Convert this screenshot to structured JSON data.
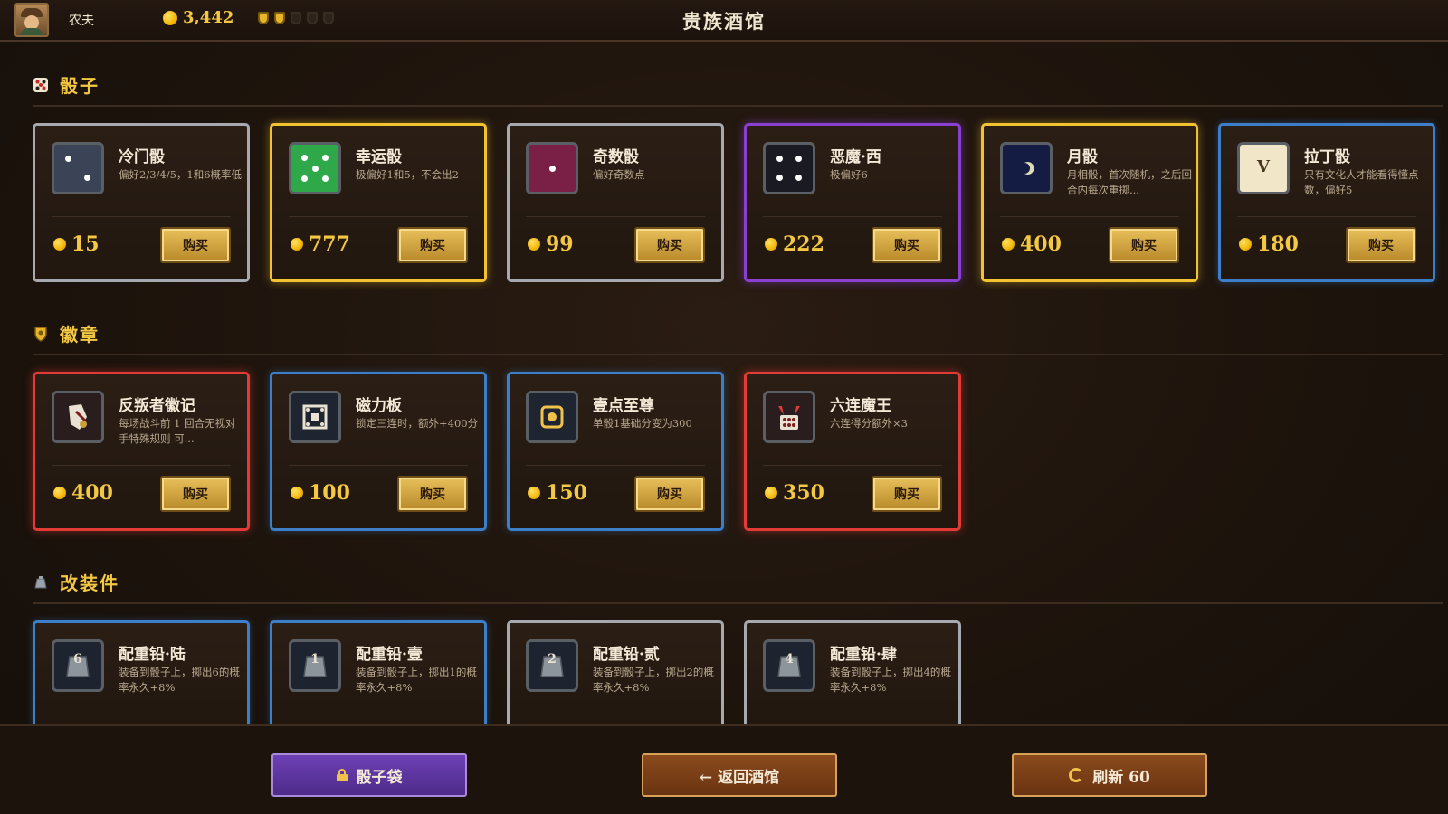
{
  "header": {
    "player_name": "农夫",
    "gold": "3,442",
    "shields": [
      "on",
      "on",
      "off",
      "off",
      "off"
    ],
    "title": "贵族酒馆"
  },
  "sections": {
    "dice": {
      "label": "骰子",
      "items": [
        {
          "name": "冷门骰",
          "desc": "偏好2/3/4/5，1和6概率低",
          "price": "15",
          "buy": "购买",
          "rarity": "gray",
          "icon": "dice-two-icon",
          "icon_color": "#3a4456"
        },
        {
          "name": "幸运骰",
          "desc": "极偏好1和5，不会出2",
          "price": "777",
          "buy": "购买",
          "rarity": "gold",
          "icon": "dice-five-icon",
          "icon_color": "#2fa84a"
        },
        {
          "name": "奇数骰",
          "desc": "偏好奇数点",
          "price": "99",
          "buy": "购买",
          "rarity": "gray",
          "icon": "dice-one-icon",
          "icon_color": "#7a1f45"
        },
        {
          "name": "恶魔·西",
          "desc": "极偏好6",
          "price": "222",
          "buy": "购买",
          "rarity": "purple",
          "icon": "dice-four-icon",
          "icon_color": "#1a1a22"
        },
        {
          "name": "月骰",
          "desc": "月相骰，首次随机，之后回合内每次重掷...",
          "price": "400",
          "buy": "购买",
          "rarity": "gold",
          "icon": "moon-dice-icon",
          "icon_color": "#141c44"
        },
        {
          "name": "拉丁骰",
          "desc": "只有文化人才能看得懂点数，偏好5",
          "price": "180",
          "buy": "购买",
          "rarity": "blue",
          "icon": "latin-dice-icon",
          "icon_color": "#f1e6c8",
          "glyph": "V"
        }
      ]
    },
    "badges": {
      "label": "徽章",
      "items": [
        {
          "name": "反叛者徽记",
          "desc": "每场战斗前 1 回合无视对手特殊规则 可...",
          "price": "400",
          "buy": "购买",
          "rarity": "red",
          "icon": "rebel-badge-icon",
          "icon_color": "#2a1d1d"
        },
        {
          "name": "磁力板",
          "desc": "锁定三连时，额外+400分",
          "price": "100",
          "buy": "购买",
          "rarity": "blue",
          "icon": "magnet-board-icon",
          "icon_color": "#1e2430"
        },
        {
          "name": "壹点至尊",
          "desc": "单骰1基础分变为300",
          "price": "150",
          "buy": "购买",
          "rarity": "blue",
          "icon": "one-supreme-icon",
          "icon_color": "#1e2430"
        },
        {
          "name": "六连魔王",
          "desc": "六连得分额外×3",
          "price": "350",
          "buy": "购买",
          "rarity": "red",
          "icon": "six-demon-icon",
          "icon_color": "#2a1d1d"
        }
      ]
    },
    "mods": {
      "label": "改装件",
      "items": [
        {
          "name": "配重铅·陆",
          "desc": "装备到骰子上，掷出6的概率永久+8%",
          "rarity": "blue",
          "icon": "weight-six-icon",
          "glyph": "6"
        },
        {
          "name": "配重铅·壹",
          "desc": "装备到骰子上，掷出1的概率永久+8%",
          "rarity": "blue",
          "icon": "weight-one-icon",
          "glyph": "1"
        },
        {
          "name": "配重铅·贰",
          "desc": "装备到骰子上，掷出2的概率永久+8%",
          "rarity": "gray",
          "icon": "weight-two-icon",
          "glyph": "2"
        },
        {
          "name": "配重铅·肆",
          "desc": "装备到骰子上，掷出4的概率永久+8%",
          "rarity": "gray",
          "icon": "weight-four-icon",
          "glyph": "4"
        }
      ]
    }
  },
  "footer": {
    "bag_label": "骰子袋",
    "back_label": "← 返回酒馆",
    "refresh_label": "刷新 60"
  },
  "colors": {
    "accent_gold": "#f4c842",
    "rarity_gray": "#a6aab0",
    "rarity_gold": "#f2c230",
    "rarity_purple": "#8a3fd1",
    "rarity_blue": "#3c7fc8",
    "rarity_red": "#e23a35"
  }
}
